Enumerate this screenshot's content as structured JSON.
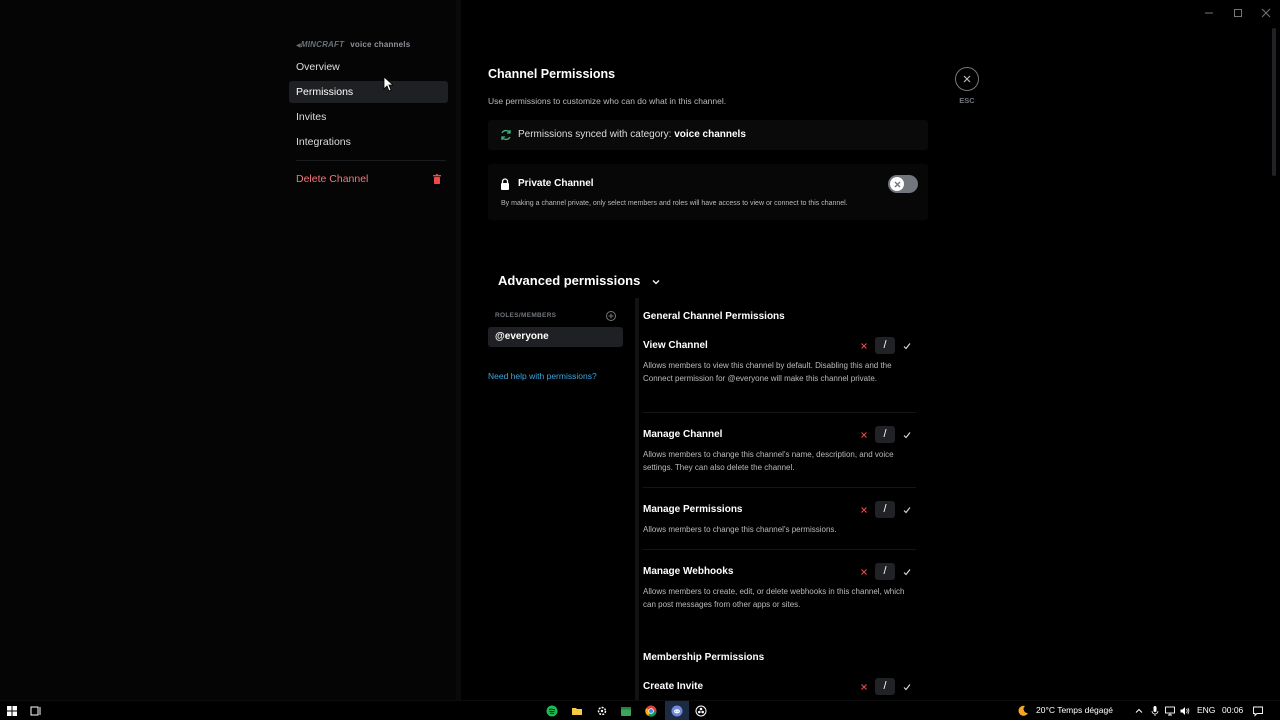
{
  "sidebar": {
    "server_name": "MINCRAFT",
    "category": "voice channels",
    "items": [
      {
        "label": "Overview"
      },
      {
        "label": "Permissions"
      },
      {
        "label": "Invites"
      },
      {
        "label": "Integrations"
      }
    ],
    "delete_label": "Delete Channel"
  },
  "main": {
    "title": "Channel Permissions",
    "subtitle": "Use permissions to customize who can do what in this channel.",
    "esc_label": "ESC",
    "sync": {
      "text": "Permissions synced with category:",
      "category": "voice channels"
    },
    "private": {
      "title": "Private Channel",
      "description": "By making a channel private, only select members and roles will have access to view or connect to this channel.",
      "enabled": false
    },
    "advanced_title": "Advanced permissions",
    "roles_label": "ROLES/MEMBERS",
    "selected_role": "@everyone",
    "help_link": "Need help with permissions?",
    "sections": [
      {
        "title": "General Channel Permissions",
        "permissions": [
          {
            "name": "View Channel",
            "description": "Allows members to view this channel by default. Disabling this and the Connect permission for @everyone will make this channel private."
          },
          {
            "name": "Manage Channel",
            "description": "Allows members to change this channel's name, description, and voice settings. They can also delete the channel."
          },
          {
            "name": "Manage Permissions",
            "description": "Allows members to change this channel's permissions."
          },
          {
            "name": "Manage Webhooks",
            "description": "Allows members to create, edit, or delete webhooks in this channel, which can post messages from other apps or sites."
          }
        ]
      },
      {
        "title": "Membership Permissions",
        "permissions": [
          {
            "name": "Create Invite",
            "description": ""
          }
        ]
      }
    ],
    "neutral_symbol": "/"
  },
  "taskbar": {
    "weather": "20°C  Temps dégagé",
    "language": "ENG",
    "time": "00:06"
  },
  "colors": {
    "deny": "#f04747",
    "link": "#3aa7e0",
    "danger": "#f2787f"
  },
  "icons": [
    "speaker-icon",
    "trash-icon",
    "close-icon",
    "sync-icon",
    "lock-icon",
    "chevron-down-icon",
    "add-circle-icon",
    "deny-x-icon",
    "allow-check-icon",
    "windows-start-icon"
  ]
}
